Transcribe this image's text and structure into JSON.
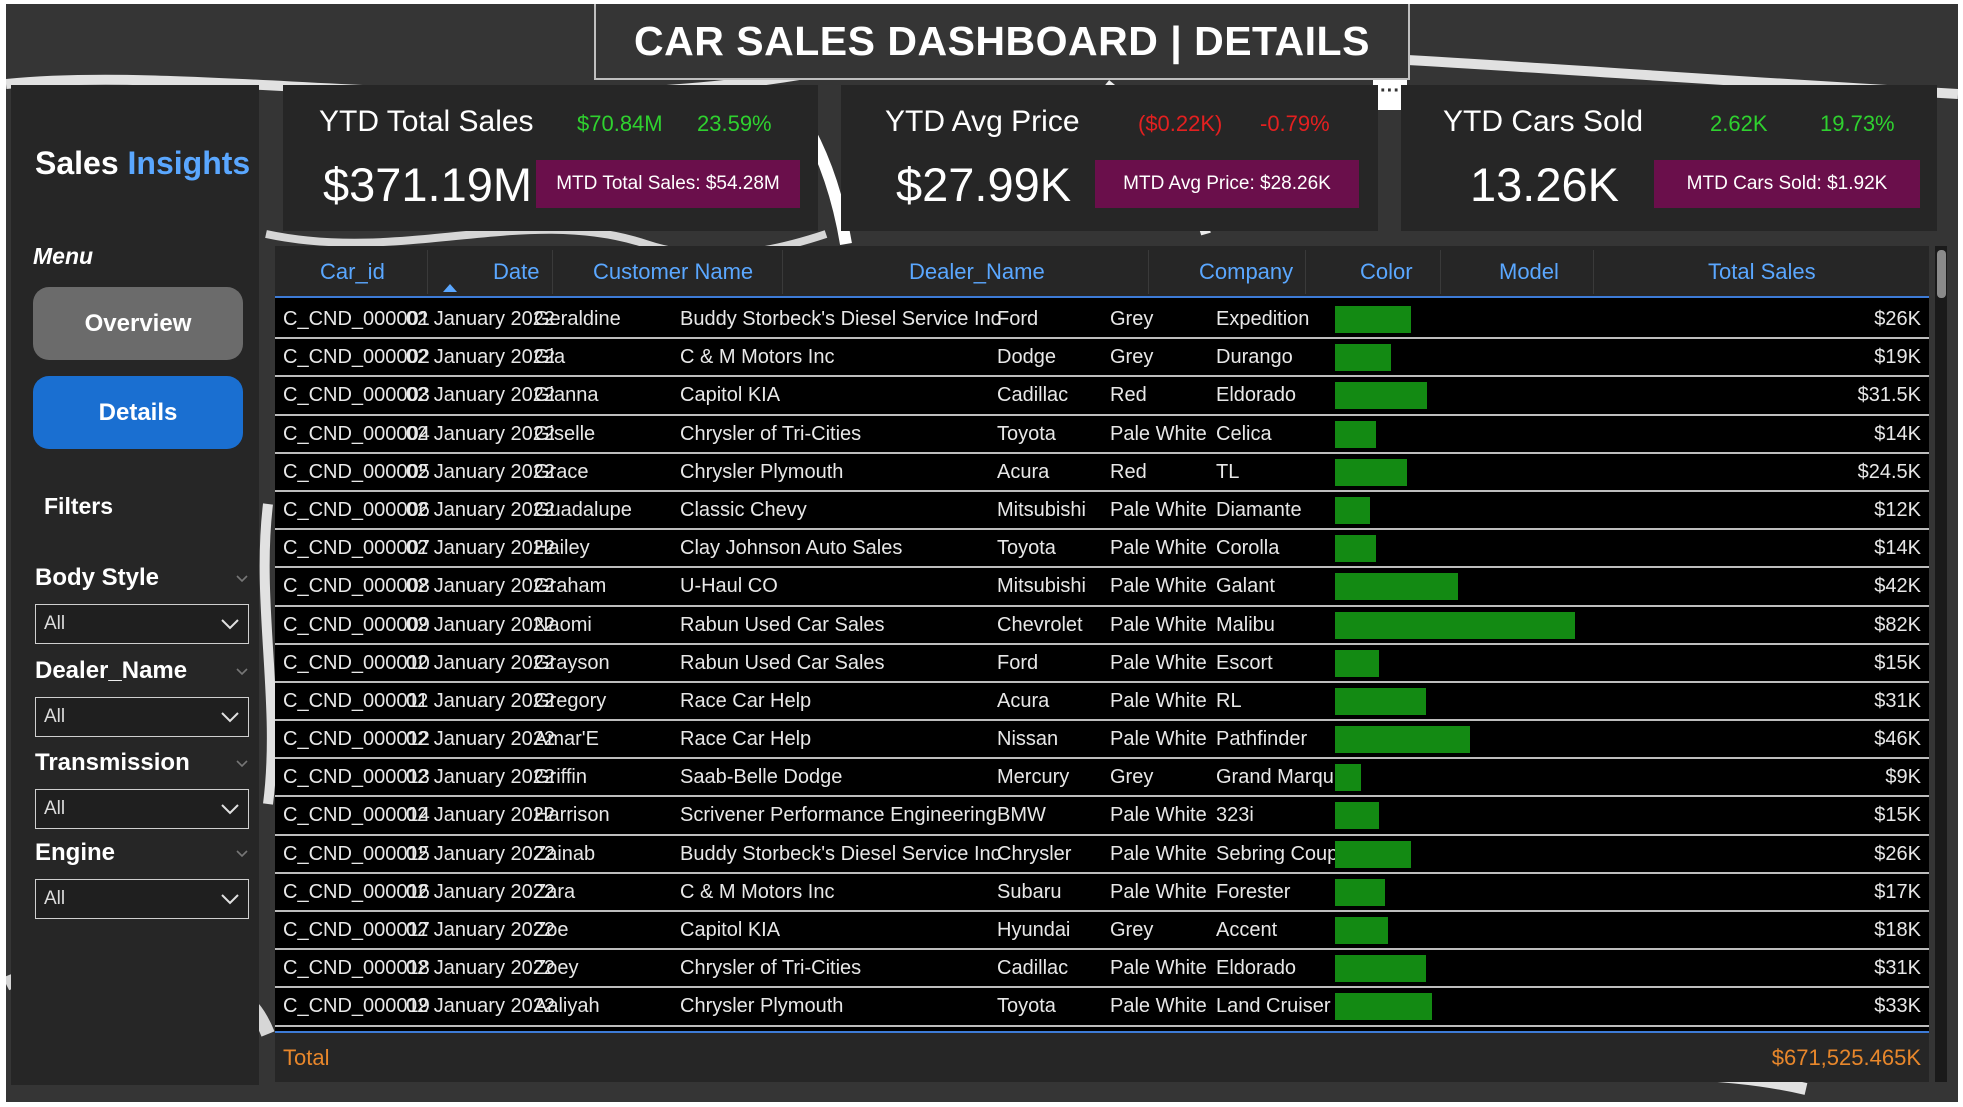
{
  "header": {
    "title": "CAR SALES DASHBOARD | DETAILS",
    "more_label": "···"
  },
  "sidebar": {
    "brand_primary": "Sales",
    "brand_accent": "Insights",
    "menu_label": "Menu",
    "nav": [
      {
        "label": "Overview"
      },
      {
        "label": "Details"
      }
    ],
    "filters_label": "Filters",
    "filters": [
      {
        "title": "Body Style",
        "value": "All"
      },
      {
        "title": "Dealer_Name",
        "value": "All"
      },
      {
        "title": "Transmission",
        "value": "All"
      },
      {
        "title": "Engine",
        "value": "All"
      }
    ]
  },
  "kpis": [
    {
      "title": "YTD Total Sales",
      "delta_value": "$70.84M",
      "delta_pct": "23.59%",
      "value": "$371.19M",
      "mtd": "MTD Total Sales: $54.28M",
      "trend": "up"
    },
    {
      "title": "YTD Avg Price",
      "delta_value": "($0.22K)",
      "delta_pct": "-0.79%",
      "value": "$27.99K",
      "mtd": "MTD Avg Price: $28.26K",
      "trend": "down"
    },
    {
      "title": "YTD Cars Sold",
      "delta_value": "2.62K",
      "delta_pct": "19.73%",
      "value": "13.26K",
      "mtd": "MTD Cars Sold: $1.92K",
      "trend": "up"
    }
  ],
  "table": {
    "columns": [
      "Car_id",
      "Date",
      "Customer Name",
      "Dealer_Name",
      "Company",
      "Color",
      "Model",
      "Total Sales"
    ],
    "bar_max_sales_k": 82,
    "rows": [
      {
        "car_id": "C_CND_000001",
        "date": "02 January 2022",
        "customer": "Geraldine",
        "dealer": "Buddy Storbeck's Diesel Service Inc",
        "company": "Ford",
        "color": "Grey",
        "model": "Expedition",
        "total_sales": "$26K",
        "sales_k": 26
      },
      {
        "car_id": "C_CND_000002",
        "date": "02 January 2022",
        "customer": "Gia",
        "dealer": "C & M Motors Inc",
        "company": "Dodge",
        "color": "Grey",
        "model": "Durango",
        "total_sales": "$19K",
        "sales_k": 19
      },
      {
        "car_id": "C_CND_000003",
        "date": "02 January 2022",
        "customer": "Gianna",
        "dealer": "Capitol KIA",
        "company": "Cadillac",
        "color": "Red",
        "model": "Eldorado",
        "total_sales": "$31.5K",
        "sales_k": 31.5
      },
      {
        "car_id": "C_CND_000004",
        "date": "02 January 2022",
        "customer": "Giselle",
        "dealer": "Chrysler of Tri-Cities",
        "company": "Toyota",
        "color": "Pale White",
        "model": "Celica",
        "total_sales": "$14K",
        "sales_k": 14
      },
      {
        "car_id": "C_CND_000005",
        "date": "02 January 2022",
        "customer": "Grace",
        "dealer": "Chrysler Plymouth",
        "company": "Acura",
        "color": "Red",
        "model": "TL",
        "total_sales": "$24.5K",
        "sales_k": 24.5
      },
      {
        "car_id": "C_CND_000006",
        "date": "02 January 2022",
        "customer": "Guadalupe",
        "dealer": "Classic Chevy",
        "company": "Mitsubishi",
        "color": "Pale White",
        "model": "Diamante",
        "total_sales": "$12K",
        "sales_k": 12
      },
      {
        "car_id": "C_CND_000007",
        "date": "02 January 2022",
        "customer": "Hailey",
        "dealer": "Clay Johnson Auto Sales",
        "company": "Toyota",
        "color": "Pale White",
        "model": "Corolla",
        "total_sales": "$14K",
        "sales_k": 14
      },
      {
        "car_id": "C_CND_000008",
        "date": "02 January 2022",
        "customer": "Graham",
        "dealer": "U-Haul CO",
        "company": "Mitsubishi",
        "color": "Pale White",
        "model": "Galant",
        "total_sales": "$42K",
        "sales_k": 42
      },
      {
        "car_id": "C_CND_000009",
        "date": "02 January 2022",
        "customer": "Naomi",
        "dealer": "Rabun Used Car Sales",
        "company": "Chevrolet",
        "color": "Pale White",
        "model": "Malibu",
        "total_sales": "$82K",
        "sales_k": 82
      },
      {
        "car_id": "C_CND_000010",
        "date": "02 January 2022",
        "customer": "Grayson",
        "dealer": "Rabun Used Car Sales",
        "company": "Ford",
        "color": "Pale White",
        "model": "Escort",
        "total_sales": "$15K",
        "sales_k": 15
      },
      {
        "car_id": "C_CND_000011",
        "date": "02 January 2022",
        "customer": "Gregory",
        "dealer": "Race Car Help",
        "company": "Acura",
        "color": "Pale White",
        "model": "RL",
        "total_sales": "$31K",
        "sales_k": 31
      },
      {
        "car_id": "C_CND_000012",
        "date": "02 January 2022",
        "customer": "Amar'E",
        "dealer": "Race Car Help",
        "company": "Nissan",
        "color": "Pale White",
        "model": "Pathfinder",
        "total_sales": "$46K",
        "sales_k": 46
      },
      {
        "car_id": "C_CND_000013",
        "date": "02 January 2022",
        "customer": "Griffin",
        "dealer": "Saab-Belle Dodge",
        "company": "Mercury",
        "color": "Grey",
        "model": "Grand Marquis",
        "total_sales": "$9K",
        "sales_k": 9
      },
      {
        "car_id": "C_CND_000014",
        "date": "02 January 2022",
        "customer": "Harrison",
        "dealer": "Scrivener Performance Engineering",
        "company": "BMW",
        "color": "Pale White",
        "model": "323i",
        "total_sales": "$15K",
        "sales_k": 15
      },
      {
        "car_id": "C_CND_000015",
        "date": "02 January 2022",
        "customer": "Zainab",
        "dealer": "Buddy Storbeck's Diesel Service Inc",
        "company": "Chrysler",
        "color": "Pale White",
        "model": "Sebring Coupe",
        "total_sales": "$26K",
        "sales_k": 26
      },
      {
        "car_id": "C_CND_000016",
        "date": "02 January 2022",
        "customer": "Zara",
        "dealer": "C & M Motors Inc",
        "company": "Subaru",
        "color": "Pale White",
        "model": "Forester",
        "total_sales": "$17K",
        "sales_k": 17
      },
      {
        "car_id": "C_CND_000017",
        "date": "02 January 2022",
        "customer": "Zoe",
        "dealer": "Capitol KIA",
        "company": "Hyundai",
        "color": "Grey",
        "model": "Accent",
        "total_sales": "$18K",
        "sales_k": 18
      },
      {
        "car_id": "C_CND_000018",
        "date": "02 January 2022",
        "customer": "Zoey",
        "dealer": "Chrysler of Tri-Cities",
        "company": "Cadillac",
        "color": "Pale White",
        "model": "Eldorado",
        "total_sales": "$31K",
        "sales_k": 31
      },
      {
        "car_id": "C_CND_000019",
        "date": "02 January 2022",
        "customer": "Aaliyah",
        "dealer": "Chrysler Plymouth",
        "company": "Toyota",
        "color": "Pale White",
        "model": "Land Cruiser",
        "total_sales": "$33K",
        "sales_k": 33
      }
    ],
    "total_label": "Total",
    "total_value": "$671,525.465K"
  },
  "colors": {
    "accent": "#5aa7ff",
    "positive": "#2fd12f",
    "negative": "#e32020",
    "mtd_bg": "#6a0f4b",
    "bar": "#138a13",
    "total": "#e8872b"
  }
}
